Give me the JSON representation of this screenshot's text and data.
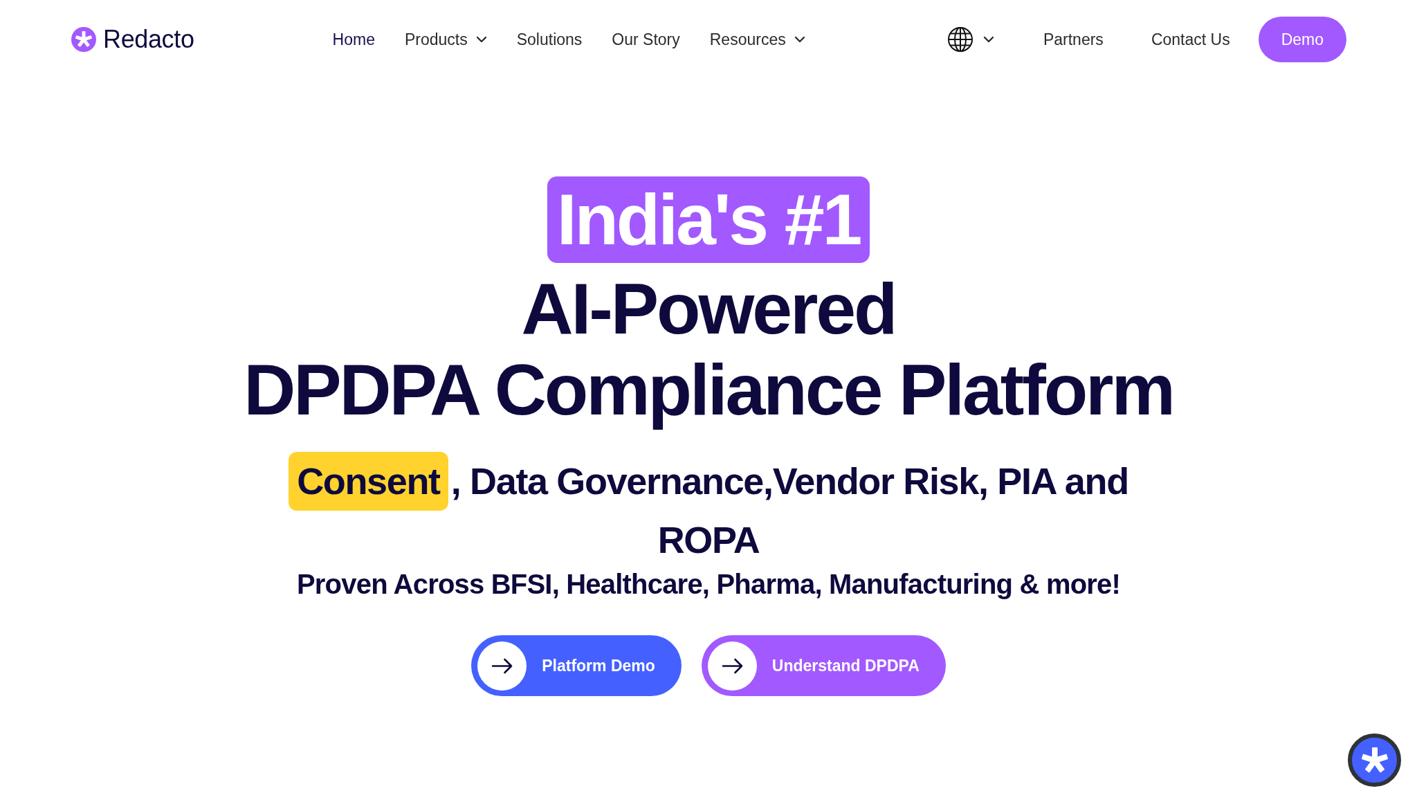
{
  "header": {
    "logo": "Redacto",
    "nav": [
      {
        "label": "Home",
        "kind": "link",
        "selected": true
      },
      {
        "label": "Products",
        "kind": "dropdown",
        "selected": false
      },
      {
        "label": "Solutions",
        "kind": "link",
        "selected": false
      },
      {
        "label": "Our Story",
        "kind": "link",
        "selected": false
      },
      {
        "label": "Resources",
        "kind": "dropdown",
        "selected": false
      }
    ],
    "secondary_links": [
      {
        "label": "Partners",
        "selected": false
      },
      {
        "label": "Contact Us",
        "selected": false
      }
    ],
    "cta": "Demo"
  },
  "hero": {
    "badge": "India's #1",
    "title_lines": [
      "AI-Powered",
      "DPDPA Compliance Platform"
    ],
    "subtitle": {
      "highlight": "Consent",
      "lines": [
        ", Data Governance,Vendor Risk, PIA and",
        "ROPA"
      ]
    },
    "tagline": "Proven Across BFSI, Healthcare, Pharma, Manufacturing & more!",
    "buttons": [
      {
        "label": "Platform Demo",
        "color": "#4461ff"
      },
      {
        "label": "Understand DPDPA",
        "color": "#a259ff"
      }
    ]
  }
}
